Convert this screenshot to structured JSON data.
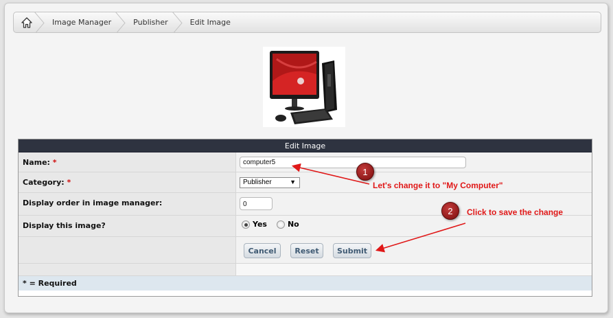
{
  "breadcrumb": {
    "home_icon": "home-icon",
    "items": [
      "Image Manager",
      "Publisher",
      "Edit Image"
    ]
  },
  "form": {
    "header": "Edit Image",
    "name_label": "Name:",
    "name_value": "computer5",
    "category_label": "Category:",
    "category_value": "Publisher",
    "order_label": "Display order in image manager:",
    "order_value": "0",
    "display_label": "Display this image?",
    "yes_label": "Yes",
    "no_label": "No",
    "display_selected": "Yes",
    "required_mark": "*",
    "required_note": "* = Required"
  },
  "buttons": {
    "cancel": "Cancel",
    "reset": "Reset",
    "submit": "Submit"
  },
  "annotations": {
    "step1_number": "1",
    "step1_text": "Let's change it to \"My Computer\"",
    "step2_number": "2",
    "step2_text": "Click to save the change"
  },
  "colors": {
    "annotation": "#e01818",
    "header_bg": "#2e3340",
    "button_text": "#3f5a73"
  }
}
